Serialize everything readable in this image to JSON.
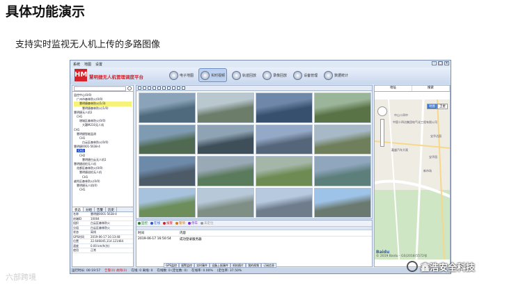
{
  "slide": {
    "title": "具体功能演示",
    "subtitle": "支持实时监视无人机上传的多路图像"
  },
  "app": {
    "menu": [
      "系统",
      "地图",
      "设置"
    ],
    "logo_text": "HM",
    "system_name": "慧明捷无人机管理调度平台",
    "nav": [
      {
        "label": "电子地图",
        "active": false
      },
      {
        "label": "实时视频",
        "active": true
      },
      {
        "label": "轨迹回放",
        "active": false
      },
      {
        "label": "录像回放",
        "active": false
      },
      {
        "label": "设备管理",
        "active": false
      },
      {
        "label": "数据统计",
        "active": false
      }
    ],
    "tree": [
      "监控中心(0/0)",
      "广州市森林防火(0/0)",
      "慧明捷森林防火(1/3)",
      "慧明捷森林防火(1/0)",
      "慧明捷无人机1",
      "CH1",
      "增城区森林防火(0/0)",
      "大疆M210无人机",
      "CH1",
      "慧明捷智能监测",
      "CH1",
      "白云区森林防火(0/0)",
      "慧明捷0001-5638-4",
      "CH1",
      "CH2",
      "慧明捷白云无人机1",
      "慧明捷巡检无人机",
      "花都区森林防火(0/0)",
      "慧明捷巡检无人机",
      "CH1",
      "越秀区森林防火(0/0)",
      "慧明捷无人机(0)",
      "CH1"
    ],
    "tree_selected_index": 2,
    "tree_highlight_index": 13,
    "left_tabs": [
      "状态",
      "分组",
      "告警",
      "历史"
    ],
    "properties": [
      {
        "k": "名称",
        "v": "慧明捷0001-5638-4"
      },
      {
        "k": "终端ID",
        "v": "10004"
      },
      {
        "k": "组织",
        "v": "白云区森林防火"
      },
      {
        "k": "分组",
        "v": "白云区森林防火"
      },
      {
        "k": "状态",
        "v": "离线"
      },
      {
        "k": "GPS时间",
        "v": "2019-06-17 16:13:48"
      },
      {
        "k": "位置",
        "v": "22.646045,114.121464"
      },
      {
        "k": "速度",
        "v": "0.00 km/h(东)"
      },
      {
        "k": "使用",
        "v": "正常"
      }
    ],
    "event_filters": [
      {
        "label": "监控",
        "color": "#2a7d2a"
      },
      {
        "label": "在线",
        "color": "#2a55c9"
      },
      {
        "label": "报警",
        "color": "#d4232b"
      },
      {
        "label": "警情",
        "color": "#d47a1a"
      },
      {
        "label": "停车",
        "color": "#7a2ad4"
      },
      {
        "label": "未定位",
        "color": "#999999"
      }
    ],
    "event_header": [
      "时间",
      "内容"
    ],
    "events": [
      {
        "time": "2019-06-17 16:50:54",
        "content": "成功登录服务器"
      }
    ],
    "map": {
      "tabs": [
        "地址",
        "搜索"
      ],
      "types": [
        "地图",
        "卫星"
      ],
      "places": [
        "中山十四中",
        "中国十四冶集团电气化工程有限公司",
        "宝华达园",
        "嘉盛汽车大观",
        "新市场",
        "宝华园"
      ],
      "copyright": "© 2019 Baidu - GS(2018)5572号",
      "logo": "Baidu"
    },
    "bottom_tabs": [
      "GPS监控",
      "报警监控",
      "实时事件",
      "设备上报事件",
      "抓拍图片",
      "我的视频",
      "订阅信息"
    ],
    "status": [
      "运行时长: 00:19:57",
      "在线: 0 离线: 0",
      "在线数: 0 (定位数: 0)",
      "在线率: 0.00%",
      "(定位率: 37.50%"
    ],
    "status_alert": "告警(0) 故障(0)"
  },
  "watermarks": {
    "left": "六部跨境",
    "right": "鑫浩安全科技"
  },
  "colors": {
    "brand_red": "#d4232b",
    "window_bg": "#dfe8f5",
    "accent_blue": "#2a55c9"
  }
}
